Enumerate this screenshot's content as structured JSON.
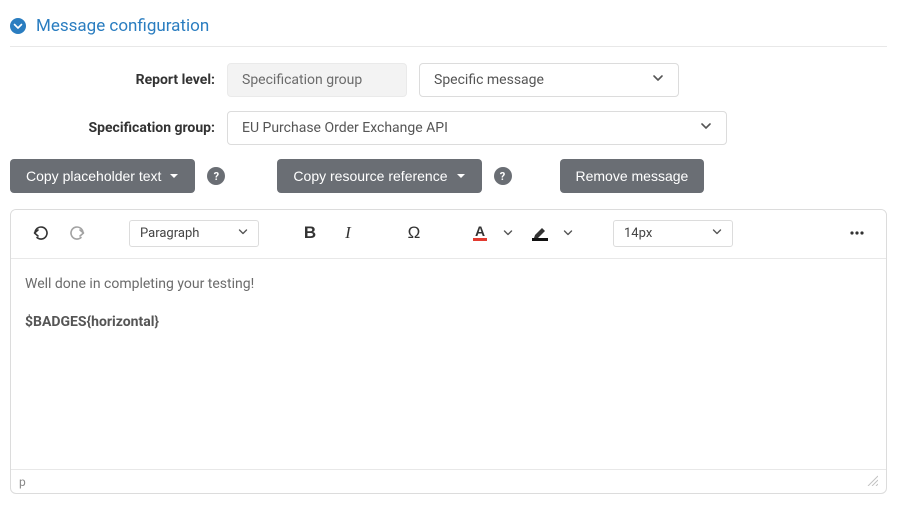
{
  "section": {
    "title": "Message configuration"
  },
  "form": {
    "report_level": {
      "label": "Report level:",
      "value": "Specification group",
      "scope_value": "Specific message"
    },
    "spec_group": {
      "label": "Specification group:",
      "value": "EU Purchase Order Exchange API"
    }
  },
  "buttons": {
    "copy_placeholder": "Copy placeholder text",
    "copy_resource": "Copy resource reference",
    "remove_message": "Remove message",
    "help": "?"
  },
  "editor": {
    "block_format": "Paragraph",
    "font_size": "14px",
    "content_line1": "Well done in completing your testing!",
    "content_line2": "$BADGES{horizontal}",
    "status_path": "p",
    "special_char": "Ω"
  }
}
